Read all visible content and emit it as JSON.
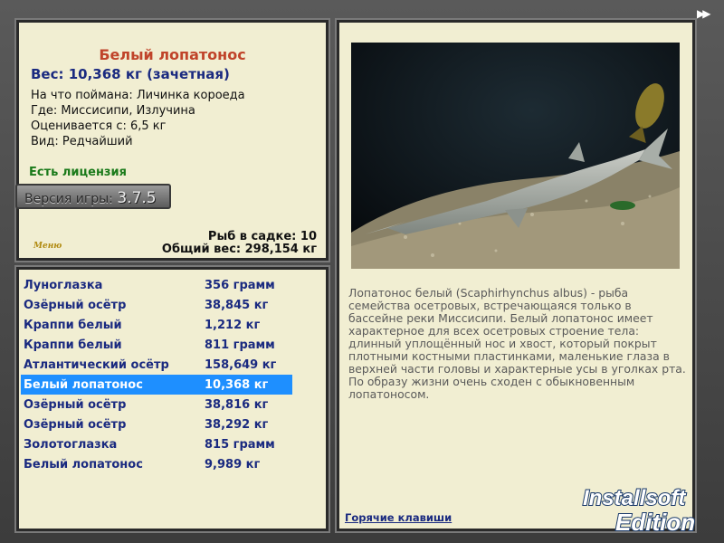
{
  "info": {
    "title": "Белый лопатонос",
    "weight": "Вес: 10,368 кг (зачетная)",
    "bait": "На что поймана: Личинка короеда",
    "place": "Где: Миссисипи, Излучина",
    "rated": "Оценивается с: 6,5 кг",
    "kind": "Вид: Редчайший",
    "license": "Есть лицензия",
    "version_label": "Версия игры:",
    "version_value": "3.7.5",
    "cage_count": "Рыб в садке: 10",
    "total_weight": "Общий вес: 298,154 кг",
    "menu": "Меню"
  },
  "catch_list": [
    {
      "name": "Луноглазка",
      "weight": "356 грамм"
    },
    {
      "name": "Озёрный осётр",
      "weight": "38,845 кг"
    },
    {
      "name": "Краппи белый",
      "weight": "1,212 кг"
    },
    {
      "name": "Краппи белый",
      "weight": "811 грамм"
    },
    {
      "name": "Атлантический осётр",
      "weight": "158,649 кг"
    },
    {
      "name": "Белый лопатонос",
      "weight": "10,368 кг",
      "selected": true
    },
    {
      "name": "Озёрный осётр",
      "weight": "38,816 кг"
    },
    {
      "name": "Озёрный осётр",
      "weight": "38,292 кг"
    },
    {
      "name": "Золотоглазка",
      "weight": "815 грамм"
    },
    {
      "name": "Белый лопатонос",
      "weight": "9,989 кг"
    }
  ],
  "detail": {
    "description": "Лопатонос белый (Scaphirhynchus albus) - рыба семейства осетровых, встречающаяся только в бассейне реки Миссисипи. Белый лопатонос имеет характерное для всех осетровых строение тела: длинный уплощённый нос и хвост, который покрыт плотными костными пластинками, маленькие глаза в верхней части головы и характерные усы в уголках рта. По образу жизни очень сходен с обыкновенным лопатоносом.",
    "hotkeys": "Горячие клавиши"
  },
  "watermark": {
    "line1": "Installsoft",
    "line2": "Edition"
  },
  "colors": {
    "panel_bg": "#f1eed2",
    "title": "#c0442a",
    "text_blue": "#1a2a80",
    "selected": "#1e8fff",
    "license_green": "#1a7a1a"
  }
}
